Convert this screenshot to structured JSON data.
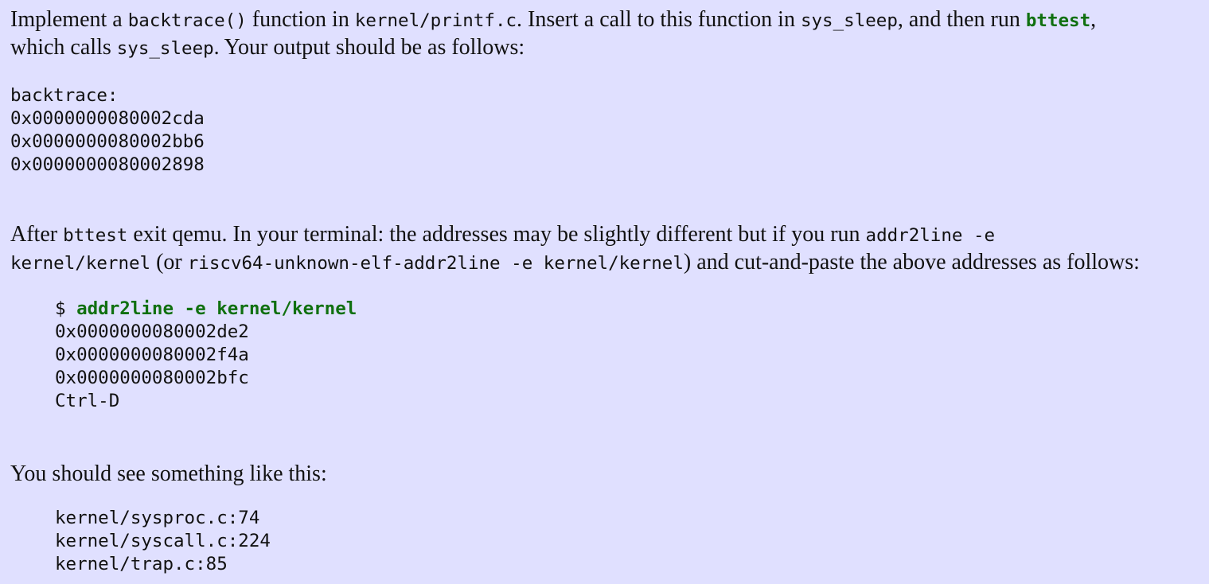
{
  "para1": {
    "t1": "Implement a ",
    "c1": "backtrace()",
    "t2": " function in ",
    "c2": "kernel/printf.c",
    "t3": ". Insert a call to this function in ",
    "c3": "sys_sleep",
    "t4": ", and then run ",
    "c4": "bttest",
    "t5": ",",
    "t6": "which calls ",
    "c5": "sys_sleep",
    "t7": ". Your output should be as follows:"
  },
  "output1": [
    "backtrace:",
    "0x0000000080002cda",
    "0x0000000080002bb6",
    "0x0000000080002898"
  ],
  "para2": {
    "t1": "After ",
    "c1": "bttest",
    "t2": " exit qemu. In your terminal: the addresses may be slightly different but if you run ",
    "c2": "addr2line -e",
    "c3": "kernel/kernel",
    "t3": " (or ",
    "c4": "riscv64-unknown-elf-addr2line -e kernel/kernel",
    "t4": ") and cut-and-paste the above addresses as follows:"
  },
  "terminal": {
    "prompt": "$ ",
    "command": "addr2line -e kernel/kernel",
    "lines": [
      "0x0000000080002de2",
      "0x0000000080002f4a",
      "0x0000000080002bfc",
      "Ctrl-D"
    ]
  },
  "para3": "You should see something like this:",
  "output2": [
    "kernel/sysproc.c:74",
    "kernel/syscall.c:224",
    "kernel/trap.c:85"
  ]
}
